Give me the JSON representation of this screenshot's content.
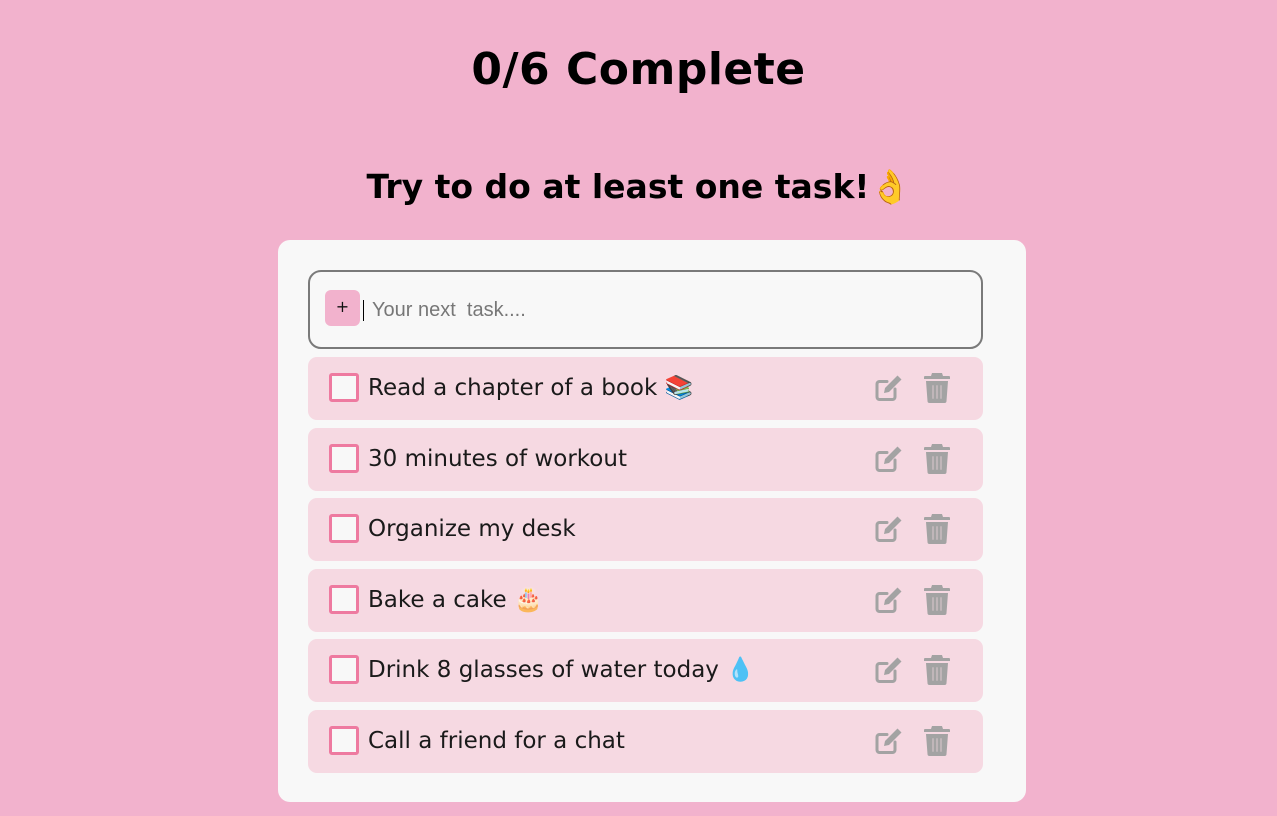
{
  "header": {
    "progress_text": "0/6 Complete",
    "motivation_text": "Try to do at least one task!👌"
  },
  "new_task": {
    "add_button_label": "+",
    "placeholder": "Your next  task...."
  },
  "tasks": [
    {
      "text": "Read a chapter of a book 📚",
      "completed": false
    },
    {
      "text": "30 minutes of workout",
      "completed": false
    },
    {
      "text": "Organize my desk",
      "completed": false
    },
    {
      "text": "Bake a cake 🎂",
      "completed": false
    },
    {
      "text": "Drink 8 glasses of water today 💧",
      "completed": false
    },
    {
      "text": "Call a friend for a chat",
      "completed": false
    }
  ],
  "colors": {
    "background": "#f2b2cd",
    "card": "#f8f8f8",
    "task_row": "#f6d9e2",
    "checkbox_border": "#ee7aa0",
    "icon": "#a3a3a3"
  },
  "icons": {
    "edit": "edit-icon",
    "delete": "trash-icon"
  }
}
